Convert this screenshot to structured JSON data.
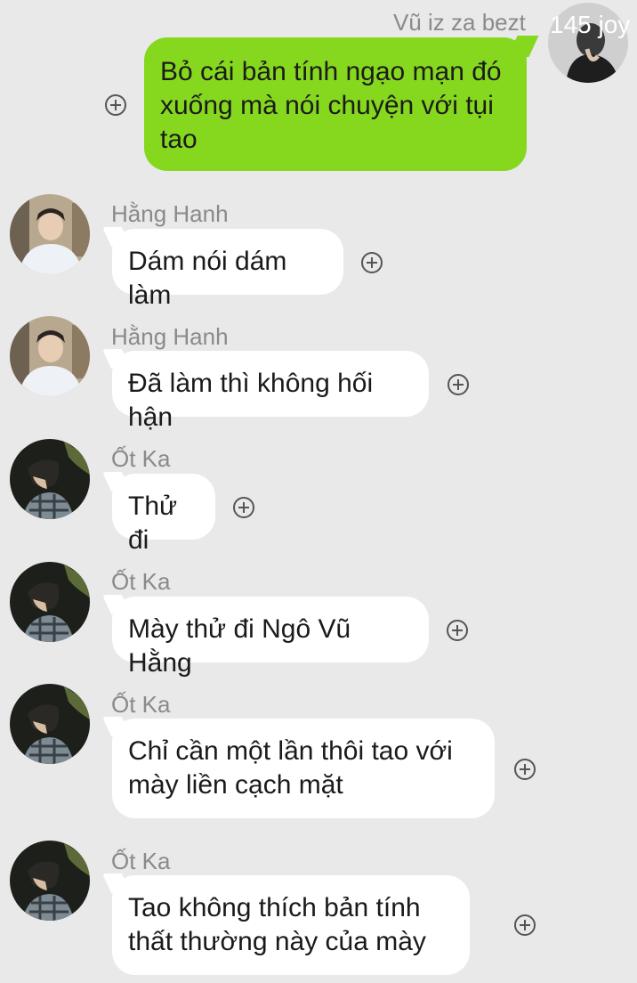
{
  "outgoing": {
    "sender": "Vũ iz za bezt",
    "avatar_label": "145 joy",
    "text": "Bỏ cái bản tính ngạo mạn đó xuống mà nói chuyện với tụi tao"
  },
  "messages": [
    {
      "sender": "Hằng Hanh",
      "text": "Dám nói dám làm",
      "avatar": "boy-white-shirt"
    },
    {
      "sender": "Hằng Hanh",
      "text": "Đã làm thì không hối hận",
      "avatar": "boy-white-shirt"
    },
    {
      "sender": "Ốt Ka",
      "text": "Thử đi",
      "avatar": "boy-profile-dark"
    },
    {
      "sender": "Ốt Ka",
      "text": "Mày thử đi Ngô Vũ Hằng",
      "avatar": "boy-profile-dark"
    },
    {
      "sender": "Ốt Ka",
      "text": "Chỉ cần một lần thôi tao với mày liền cạch mặt",
      "avatar": "boy-profile-dark"
    },
    {
      "sender": "Ốt Ka",
      "text": "Tao không thích bản tính thất thường này của mày",
      "avatar": "boy-profile-dark"
    }
  ],
  "colors": {
    "background": "#e9e9e9",
    "outgoing_bubble": "#86d81e",
    "incoming_bubble": "#ffffff",
    "sender_name": "#8a8a8a"
  },
  "icons": {
    "reaction": "plus-circle-icon"
  }
}
